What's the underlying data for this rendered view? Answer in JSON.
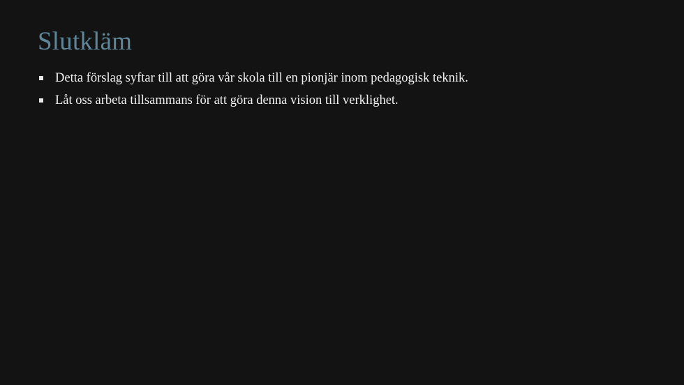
{
  "slide": {
    "title": "Slutkläm",
    "bullets": [
      "Detta förslag syftar till att göra vår skola till en pionjär inom pedagogisk teknik.",
      "Låt oss arbeta tillsammans för att göra denna vision till verklighet."
    ]
  },
  "colors": {
    "background": "#131313",
    "title": "#5f8799",
    "text": "#f2f2f2"
  }
}
